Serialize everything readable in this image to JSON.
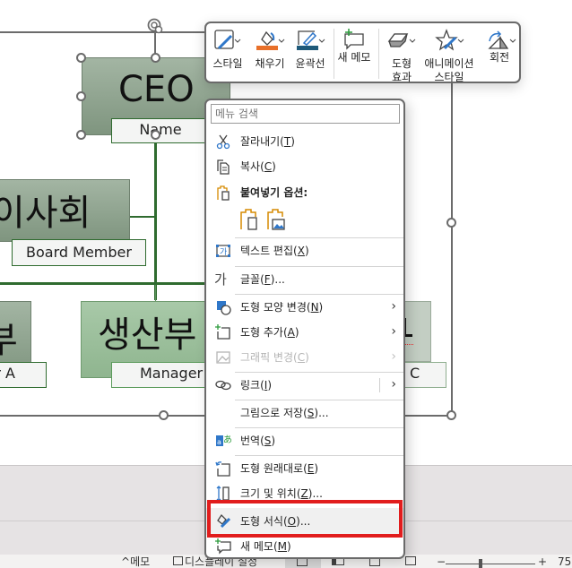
{
  "org_chart": {
    "ceo": {
      "title": "CEO",
      "name": "Name"
    },
    "board": {
      "title": "이사회",
      "name": "Board Member"
    },
    "left_dept": {
      "title": "부",
      "name": "r A"
    },
    "production": {
      "title": "생산부",
      "name": "Manager"
    },
    "right_dept": {
      "title": "",
      "name": "C"
    }
  },
  "mini_toolbar": {
    "buttons": [
      {
        "id": "style",
        "label": "스타일",
        "icon": "shape-style-icon",
        "has_dropdown": true
      },
      {
        "id": "fill",
        "label": "채우기",
        "icon": "paint-bucket-icon",
        "has_dropdown": true,
        "color": "#e8702a"
      },
      {
        "id": "outline",
        "label": "윤곽선",
        "icon": "pen-outline-icon",
        "has_dropdown": true,
        "color": "#1f5a7a"
      },
      {
        "id": "new-comment",
        "label": "새 메모",
        "icon": "new-comment-icon",
        "has_dropdown": false
      },
      {
        "id": "shape-effects",
        "label": "도형\n효과",
        "icon": "shape-effects-icon",
        "has_dropdown": true
      },
      {
        "id": "animation-styles",
        "label": "애니메이션\n스타일",
        "icon": "animation-star-icon",
        "has_dropdown": true
      },
      {
        "id": "rotate",
        "label": "회전",
        "icon": "rotate-icon",
        "has_dropdown": true
      }
    ]
  },
  "context_menu": {
    "search_placeholder": "메뉴 검색",
    "items": [
      {
        "label": "잘라내기",
        "key": "T",
        "icon": "scissors-icon",
        "enabled": true,
        "submenu": false
      },
      {
        "label": "복사",
        "key": "C",
        "icon": "copy-icon",
        "enabled": true,
        "submenu": false
      },
      {
        "label": "붙여넣기 옵션:",
        "key": "",
        "icon": "paste-icon",
        "enabled": true,
        "submenu": false,
        "bold": true
      },
      {
        "label": "텍스트 편집",
        "key": "X",
        "icon": "edit-text-icon",
        "enabled": true,
        "submenu": false
      },
      {
        "label": "글꼴",
        "key": "F",
        "suffix": "...",
        "icon": "font-icon",
        "enabled": true,
        "submenu": false
      },
      {
        "label": "도형 모양 변경",
        "key": "N",
        "icon": "change-shape-icon",
        "enabled": true,
        "submenu": true
      },
      {
        "label": "도형 추가",
        "key": "A",
        "icon": "add-shape-icon",
        "enabled": true,
        "submenu": true
      },
      {
        "label": "그래픽 변경",
        "key": "C",
        "icon": "change-graphic-icon",
        "enabled": false,
        "submenu": true
      },
      {
        "label": "링크",
        "key": "I",
        "icon": "link-icon",
        "enabled": true,
        "submenu": true
      },
      {
        "label": "그림으로 저장",
        "key": "S",
        "suffix": "...",
        "icon": "",
        "enabled": true,
        "submenu": false
      },
      {
        "label": "번역",
        "key": "S",
        "icon": "translate-icon",
        "enabled": true,
        "submenu": false
      },
      {
        "label": "도형 원래대로",
        "key": "E",
        "icon": "reset-shape-icon",
        "enabled": true,
        "submenu": false
      },
      {
        "label": "크기 및 위치",
        "key": "Z",
        "suffix": "...",
        "icon": "size-position-icon",
        "enabled": true,
        "submenu": false
      },
      {
        "label": "도형 서식",
        "key": "O",
        "suffix": "...",
        "icon": "format-shape-icon",
        "enabled": true,
        "submenu": false,
        "highlighted": true
      },
      {
        "label": "새 메모",
        "key": "M",
        "icon": "new-comment-icon",
        "enabled": true,
        "submenu": false
      }
    ],
    "paste_options": [
      "paste-keep-source-icon",
      "paste-as-picture-icon"
    ]
  },
  "status_bar": {
    "notes_label": "메모",
    "display_settings_label": "디스플레이 설정",
    "zoom_value": "75"
  },
  "colors": {
    "highlight_border": "#e11d1d",
    "connector_green": "#2f6b2f"
  }
}
